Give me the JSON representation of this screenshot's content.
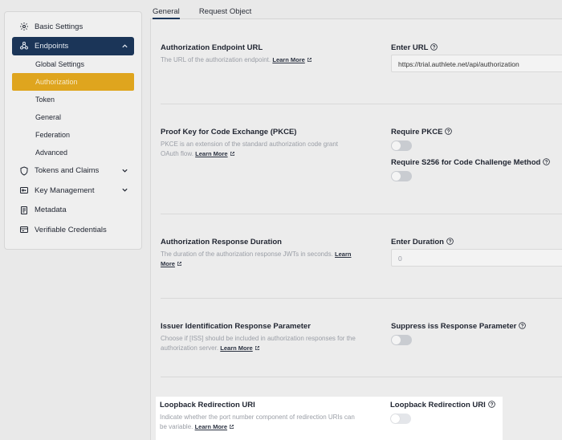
{
  "sidebar": {
    "items": [
      {
        "label": "Basic Settings",
        "icon": "gear-icon"
      },
      {
        "label": "Endpoints",
        "icon": "webhook-icon",
        "expanded": true,
        "children": [
          "Global Settings",
          "Authorization",
          "Token",
          "General",
          "Federation",
          "Advanced"
        ],
        "selected_child": "Authorization"
      },
      {
        "label": "Tokens and Claims",
        "icon": "shield-icon"
      },
      {
        "label": "Key Management",
        "icon": "key-icon"
      },
      {
        "label": "Metadata",
        "icon": "document-icon"
      },
      {
        "label": "Verifiable Credentials",
        "icon": "credential-card-icon"
      }
    ]
  },
  "tabs": [
    "General",
    "Request Object"
  ],
  "active_tab": "General",
  "learn_more": "Learn More",
  "sections": {
    "auth_endpoint": {
      "title": "Authorization Endpoint URL",
      "desc": "The URL of the authorization endpoint.",
      "field_label": "Enter URL",
      "value": "https://trial.authlete.net/api/authorization"
    },
    "pkce": {
      "title": "Proof Key for Code Exchange (PKCE)",
      "desc": "PKCE is an extension of the standard authorization code grant OAuth flow.",
      "field_label_1": "Require PKCE",
      "field_label_2": "Require S256 for Code Challenge Method"
    },
    "duration": {
      "title": "Authorization Response Duration",
      "desc": "The duration of the authorization response JWTs in seconds.",
      "field_label": "Enter Duration",
      "value": "0"
    },
    "iss": {
      "title": "Issuer Identification Response Parameter",
      "desc": "Choose if [ISS] should be included in authorization responses for the authorization server.",
      "field_label": "Suppress iss Response Parameter"
    },
    "loopback": {
      "title": "Loopback Redirection URI",
      "desc": "Indicate whether the port number component of redirection URIs can be variable.",
      "field_label": "Loopback Redirection URI"
    }
  },
  "colors": {
    "nav_active": "#1b3558",
    "sub_selected": "#dfa51e"
  }
}
